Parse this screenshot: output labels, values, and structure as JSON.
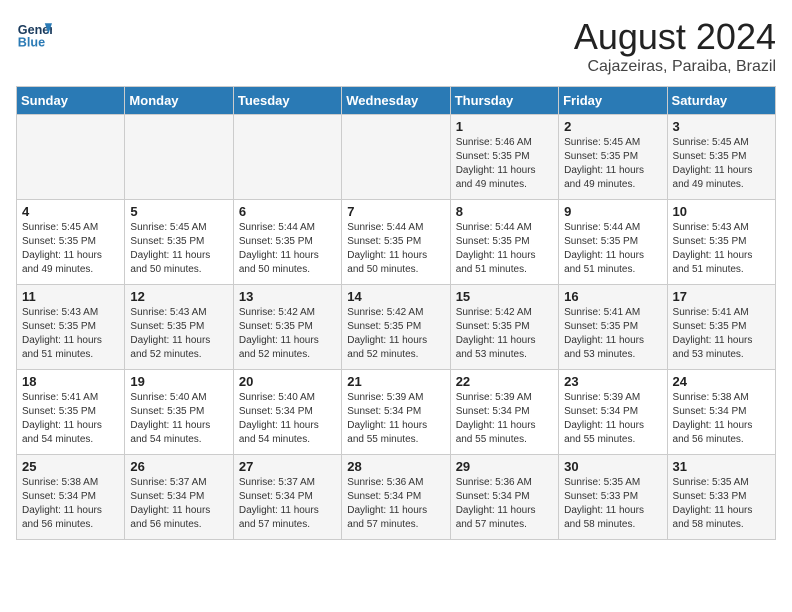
{
  "header": {
    "logo_line1": "General",
    "logo_line2": "Blue",
    "month": "August 2024",
    "location": "Cajazeiras, Paraiba, Brazil"
  },
  "weekdays": [
    "Sunday",
    "Monday",
    "Tuesday",
    "Wednesday",
    "Thursday",
    "Friday",
    "Saturday"
  ],
  "weeks": [
    [
      {
        "day": "",
        "info": ""
      },
      {
        "day": "",
        "info": ""
      },
      {
        "day": "",
        "info": ""
      },
      {
        "day": "",
        "info": ""
      },
      {
        "day": "1",
        "info": "Sunrise: 5:46 AM\nSunset: 5:35 PM\nDaylight: 11 hours\nand 49 minutes."
      },
      {
        "day": "2",
        "info": "Sunrise: 5:45 AM\nSunset: 5:35 PM\nDaylight: 11 hours\nand 49 minutes."
      },
      {
        "day": "3",
        "info": "Sunrise: 5:45 AM\nSunset: 5:35 PM\nDaylight: 11 hours\nand 49 minutes."
      }
    ],
    [
      {
        "day": "4",
        "info": "Sunrise: 5:45 AM\nSunset: 5:35 PM\nDaylight: 11 hours\nand 49 minutes."
      },
      {
        "day": "5",
        "info": "Sunrise: 5:45 AM\nSunset: 5:35 PM\nDaylight: 11 hours\nand 50 minutes."
      },
      {
        "day": "6",
        "info": "Sunrise: 5:44 AM\nSunset: 5:35 PM\nDaylight: 11 hours\nand 50 minutes."
      },
      {
        "day": "7",
        "info": "Sunrise: 5:44 AM\nSunset: 5:35 PM\nDaylight: 11 hours\nand 50 minutes."
      },
      {
        "day": "8",
        "info": "Sunrise: 5:44 AM\nSunset: 5:35 PM\nDaylight: 11 hours\nand 51 minutes."
      },
      {
        "day": "9",
        "info": "Sunrise: 5:44 AM\nSunset: 5:35 PM\nDaylight: 11 hours\nand 51 minutes."
      },
      {
        "day": "10",
        "info": "Sunrise: 5:43 AM\nSunset: 5:35 PM\nDaylight: 11 hours\nand 51 minutes."
      }
    ],
    [
      {
        "day": "11",
        "info": "Sunrise: 5:43 AM\nSunset: 5:35 PM\nDaylight: 11 hours\nand 51 minutes."
      },
      {
        "day": "12",
        "info": "Sunrise: 5:43 AM\nSunset: 5:35 PM\nDaylight: 11 hours\nand 52 minutes."
      },
      {
        "day": "13",
        "info": "Sunrise: 5:42 AM\nSunset: 5:35 PM\nDaylight: 11 hours\nand 52 minutes."
      },
      {
        "day": "14",
        "info": "Sunrise: 5:42 AM\nSunset: 5:35 PM\nDaylight: 11 hours\nand 52 minutes."
      },
      {
        "day": "15",
        "info": "Sunrise: 5:42 AM\nSunset: 5:35 PM\nDaylight: 11 hours\nand 53 minutes."
      },
      {
        "day": "16",
        "info": "Sunrise: 5:41 AM\nSunset: 5:35 PM\nDaylight: 11 hours\nand 53 minutes."
      },
      {
        "day": "17",
        "info": "Sunrise: 5:41 AM\nSunset: 5:35 PM\nDaylight: 11 hours\nand 53 minutes."
      }
    ],
    [
      {
        "day": "18",
        "info": "Sunrise: 5:41 AM\nSunset: 5:35 PM\nDaylight: 11 hours\nand 54 minutes."
      },
      {
        "day": "19",
        "info": "Sunrise: 5:40 AM\nSunset: 5:35 PM\nDaylight: 11 hours\nand 54 minutes."
      },
      {
        "day": "20",
        "info": "Sunrise: 5:40 AM\nSunset: 5:34 PM\nDaylight: 11 hours\nand 54 minutes."
      },
      {
        "day": "21",
        "info": "Sunrise: 5:39 AM\nSunset: 5:34 PM\nDaylight: 11 hours\nand 55 minutes."
      },
      {
        "day": "22",
        "info": "Sunrise: 5:39 AM\nSunset: 5:34 PM\nDaylight: 11 hours\nand 55 minutes."
      },
      {
        "day": "23",
        "info": "Sunrise: 5:39 AM\nSunset: 5:34 PM\nDaylight: 11 hours\nand 55 minutes."
      },
      {
        "day": "24",
        "info": "Sunrise: 5:38 AM\nSunset: 5:34 PM\nDaylight: 11 hours\nand 56 minutes."
      }
    ],
    [
      {
        "day": "25",
        "info": "Sunrise: 5:38 AM\nSunset: 5:34 PM\nDaylight: 11 hours\nand 56 minutes."
      },
      {
        "day": "26",
        "info": "Sunrise: 5:37 AM\nSunset: 5:34 PM\nDaylight: 11 hours\nand 56 minutes."
      },
      {
        "day": "27",
        "info": "Sunrise: 5:37 AM\nSunset: 5:34 PM\nDaylight: 11 hours\nand 57 minutes."
      },
      {
        "day": "28",
        "info": "Sunrise: 5:36 AM\nSunset: 5:34 PM\nDaylight: 11 hours\nand 57 minutes."
      },
      {
        "day": "29",
        "info": "Sunrise: 5:36 AM\nSunset: 5:34 PM\nDaylight: 11 hours\nand 57 minutes."
      },
      {
        "day": "30",
        "info": "Sunrise: 5:35 AM\nSunset: 5:33 PM\nDaylight: 11 hours\nand 58 minutes."
      },
      {
        "day": "31",
        "info": "Sunrise: 5:35 AM\nSunset: 5:33 PM\nDaylight: 11 hours\nand 58 minutes."
      }
    ]
  ]
}
